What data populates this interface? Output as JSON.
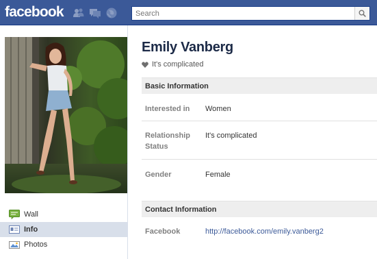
{
  "topbar": {
    "logo": "facebook",
    "search_placeholder": "Search",
    "jewels": [
      "friend-requests-icon",
      "messages-icon",
      "notifications-icon"
    ],
    "colors": {
      "bar": "#3b5998",
      "border": "#133783"
    }
  },
  "profile": {
    "name": "Emily Vanberg",
    "status": "It's complicated"
  },
  "sidebar": {
    "items": [
      {
        "label": "Wall",
        "icon": "wall-icon",
        "active": false
      },
      {
        "label": "Info",
        "icon": "info-icon",
        "active": true
      },
      {
        "label": "Photos",
        "icon": "photos-icon",
        "active": false
      }
    ]
  },
  "basic_info": {
    "header": "Basic Information",
    "rows": [
      {
        "label": "Interested in",
        "value": "Women"
      },
      {
        "label": "Relationship Status",
        "value": "It's complicated"
      },
      {
        "label": "Gender",
        "value": "Female"
      }
    ]
  },
  "contact_info": {
    "header": "Contact Information",
    "rows": [
      {
        "label": "Facebook",
        "value": "http://facebook.com/emily.vanberg2"
      }
    ]
  }
}
